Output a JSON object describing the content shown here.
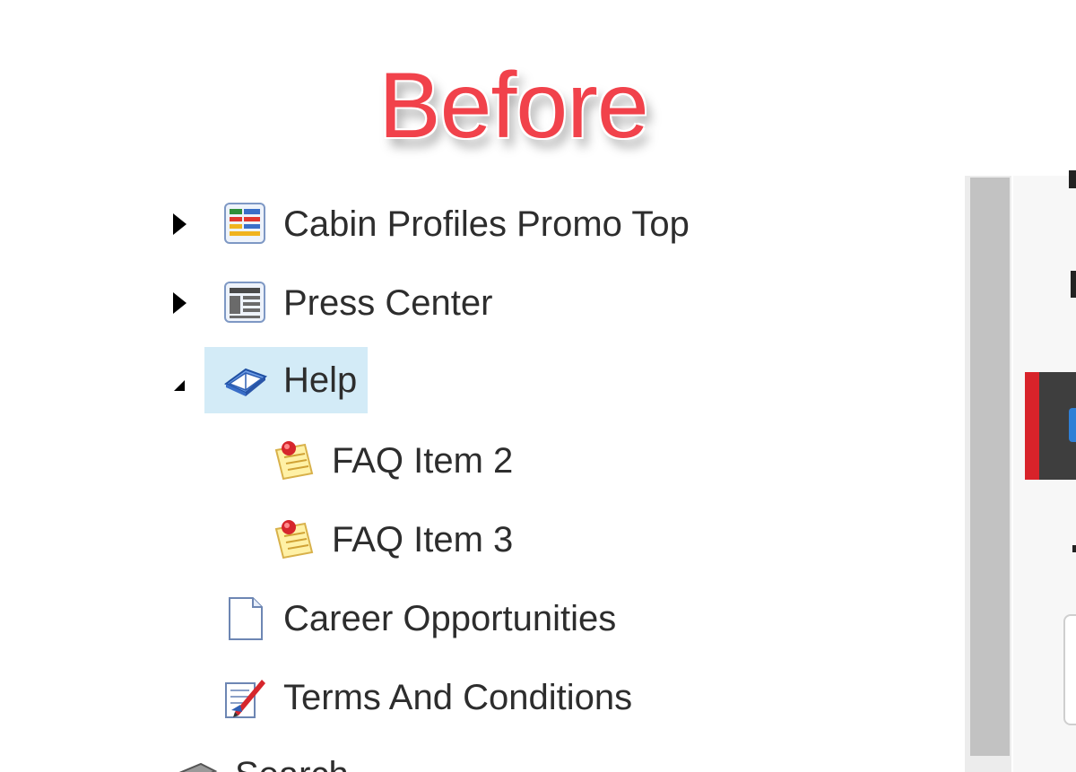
{
  "heading": {
    "text": "Before"
  },
  "tree": {
    "items": [
      {
        "label": "Cabin Profiles Promo Top",
        "icon": "colored-layout-icon",
        "toggle": "collapsed"
      },
      {
        "label": "Press Center",
        "icon": "layout-page-icon",
        "toggle": "collapsed"
      },
      {
        "label": "Help",
        "icon": "help-book-icon",
        "toggle": "expanded",
        "selected": true
      },
      {
        "label": "FAQ Item 2",
        "icon": "faq-note-icon",
        "toggle": "none"
      },
      {
        "label": "FAQ Item 3",
        "icon": "faq-note-icon",
        "toggle": "none"
      },
      {
        "label": "Career Opportunities",
        "icon": "blank-page-icon",
        "toggle": "none"
      },
      {
        "label": "Terms And Conditions",
        "icon": "edit-document-icon",
        "toggle": "none"
      },
      {
        "label": "Search",
        "icon": "search-box-icon",
        "toggle": "none"
      }
    ]
  },
  "colors": {
    "heading": "#f1424b",
    "selection": "#d3ebf7",
    "accent_red": "#d8232a",
    "dark_bar": "#3e3e3e"
  }
}
